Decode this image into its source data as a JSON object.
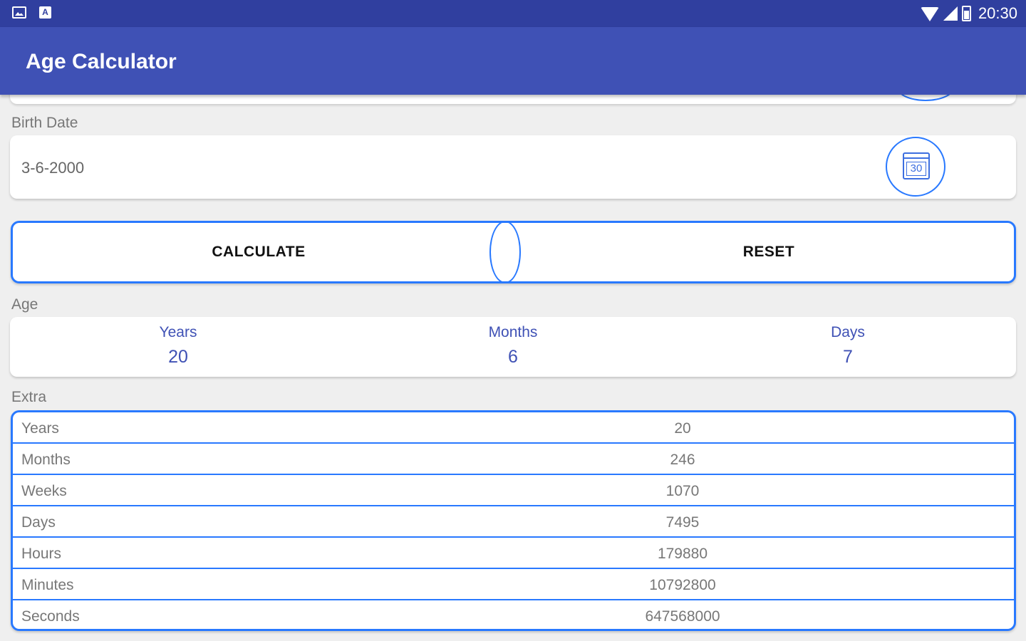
{
  "status_bar": {
    "left_icons": [
      "image-icon",
      "a-icon"
    ],
    "right_icons": [
      "wifi-icon",
      "signal-icon",
      "battery-icon"
    ],
    "time": "20:30"
  },
  "app_bar": {
    "title": "Age Calculator"
  },
  "birth_date": {
    "label": "Birth Date",
    "value": "3-6-2000",
    "calendar_icon_text": "30"
  },
  "actions": {
    "calculate_label": "CALCULATE",
    "reset_label": "RESET"
  },
  "age": {
    "label": "Age",
    "columns": [
      {
        "label": "Years",
        "value": "20"
      },
      {
        "label": "Months",
        "value": "6"
      },
      {
        "label": "Days",
        "value": "7"
      }
    ]
  },
  "extra": {
    "label": "Extra",
    "rows": [
      {
        "label": "Years",
        "value": "20"
      },
      {
        "label": "Months",
        "value": "246"
      },
      {
        "label": "Weeks",
        "value": "1070"
      },
      {
        "label": "Days",
        "value": "7495"
      },
      {
        "label": "Hours",
        "value": "179880"
      },
      {
        "label": "Minutes",
        "value": "10792800"
      },
      {
        "label": "Seconds",
        "value": "647568000"
      }
    ]
  },
  "colors": {
    "status_bar": "#303f9f",
    "app_bar": "#3f51b5",
    "accent_border": "#2979ff",
    "age_text": "#3f51b5",
    "background": "#efefef"
  }
}
